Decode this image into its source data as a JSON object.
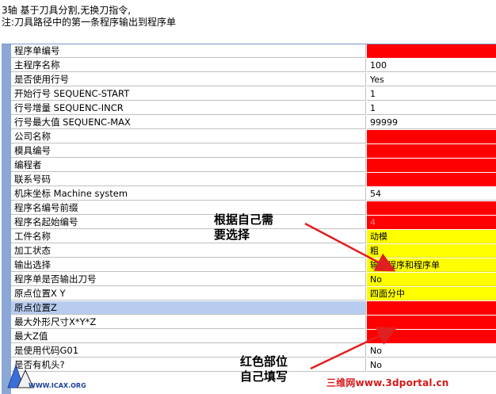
{
  "header": {
    "line1": "3轴 基于刀具分割,无换刀指令,",
    "line2": "注:刀具路径中的第一条程序输出到程序单"
  },
  "rows": [
    {
      "label": "程序单编号",
      "value": "",
      "color": "red"
    },
    {
      "label": "主程序名称",
      "value": "100",
      "color": ""
    },
    {
      "label": "是否使用行号",
      "value": "Yes",
      "color": ""
    },
    {
      "label": "开始行号 SEQUENC-START",
      "value": "1",
      "color": ""
    },
    {
      "label": "行号增量 SEQUENC-INCR",
      "value": "1",
      "color": ""
    },
    {
      "label": "行号最大值 SEQUENC-MAX",
      "value": "99999",
      "color": ""
    },
    {
      "label": "公司名称",
      "value": "",
      "color": "red"
    },
    {
      "label": "模具编号",
      "value": "",
      "color": "red"
    },
    {
      "label": "编程者",
      "value": "",
      "color": "red"
    },
    {
      "label": "联系号码",
      "value": "",
      "color": "red"
    },
    {
      "label": "机床坐标 Machine system",
      "value": "54",
      "color": ""
    },
    {
      "label": "程序名编号前缀",
      "value": "",
      "color": "red"
    },
    {
      "label": "程序名起始编号",
      "value": "4",
      "color": "red"
    },
    {
      "label": "工件名称",
      "value": "动模",
      "color": "yellow"
    },
    {
      "label": "加工状态",
      "value": "粗",
      "color": "yellow"
    },
    {
      "label": "输出选择",
      "value": "输出程序和程序单",
      "color": "yellow"
    },
    {
      "label": "程序单是否输出刀号",
      "value": "No",
      "color": "yellow"
    },
    {
      "label": "原点位置X Y",
      "value": "四面分中",
      "color": "yellow"
    },
    {
      "label": "原点位置Z",
      "value": "",
      "color": "red",
      "selected": true
    },
    {
      "label": "最大外形尺寸X*Y*Z",
      "value": "",
      "color": "red"
    },
    {
      "label": "最大Z值",
      "value": "",
      "color": "red"
    },
    {
      "label": "是使用代码G01",
      "value": "No",
      "color": ""
    },
    {
      "label": "是否有机头?",
      "value": "No",
      "color": ""
    }
  ],
  "annotations": {
    "top_line1": "根据自己需",
    "top_line2": "要选择",
    "bottom_line1": "红色部位",
    "bottom_line2": "自己填写"
  },
  "watermark": "三维网www.3dportal.cn",
  "logo_text": "WWW.ICAX.ORG",
  "colors": {
    "red": "#ff0000",
    "yellow": "#ffff00",
    "selected": "#b8ccef",
    "gutter": "#8aa7d6"
  }
}
